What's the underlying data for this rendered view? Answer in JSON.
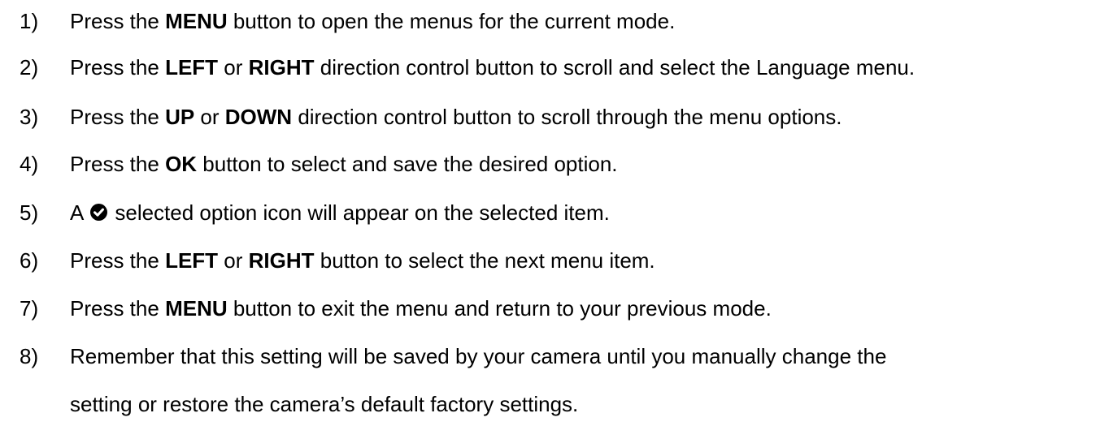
{
  "steps": [
    {
      "num": "1)",
      "parts": [
        "Press the ",
        "MENU",
        " button to open the menus for the current mode."
      ]
    },
    {
      "num": "2)",
      "parts": [
        "Press the ",
        "LEFT",
        " or ",
        "RIGHT",
        " direction control button to scroll and select the Language menu."
      ]
    },
    {
      "num": "3)",
      "parts": [
        "Press the ",
        "UP",
        " or ",
        "DOWN",
        " direction control button to scroll through the menu options."
      ]
    },
    {
      "num": "4)",
      "parts": [
        "Press the ",
        "OK",
        " button to select and save the desired option."
      ]
    },
    {
      "num": "5)",
      "before_icon": "A ",
      "icon": "check-circle-icon",
      "after_icon": " selected option icon will appear on the selected item."
    },
    {
      "num": "6)",
      "parts": [
        "Press the ",
        "LEFT",
        " or ",
        "RIGHT",
        " button to select the next menu item."
      ]
    },
    {
      "num": "7)",
      "parts": [
        "Press the ",
        "MENU",
        " button to exit the menu and return to your previous mode."
      ]
    },
    {
      "num": "8)",
      "line1": "Remember that this setting will be saved by your camera until you manually change the",
      "line2": "setting or restore the camera’s default factory settings."
    }
  ]
}
